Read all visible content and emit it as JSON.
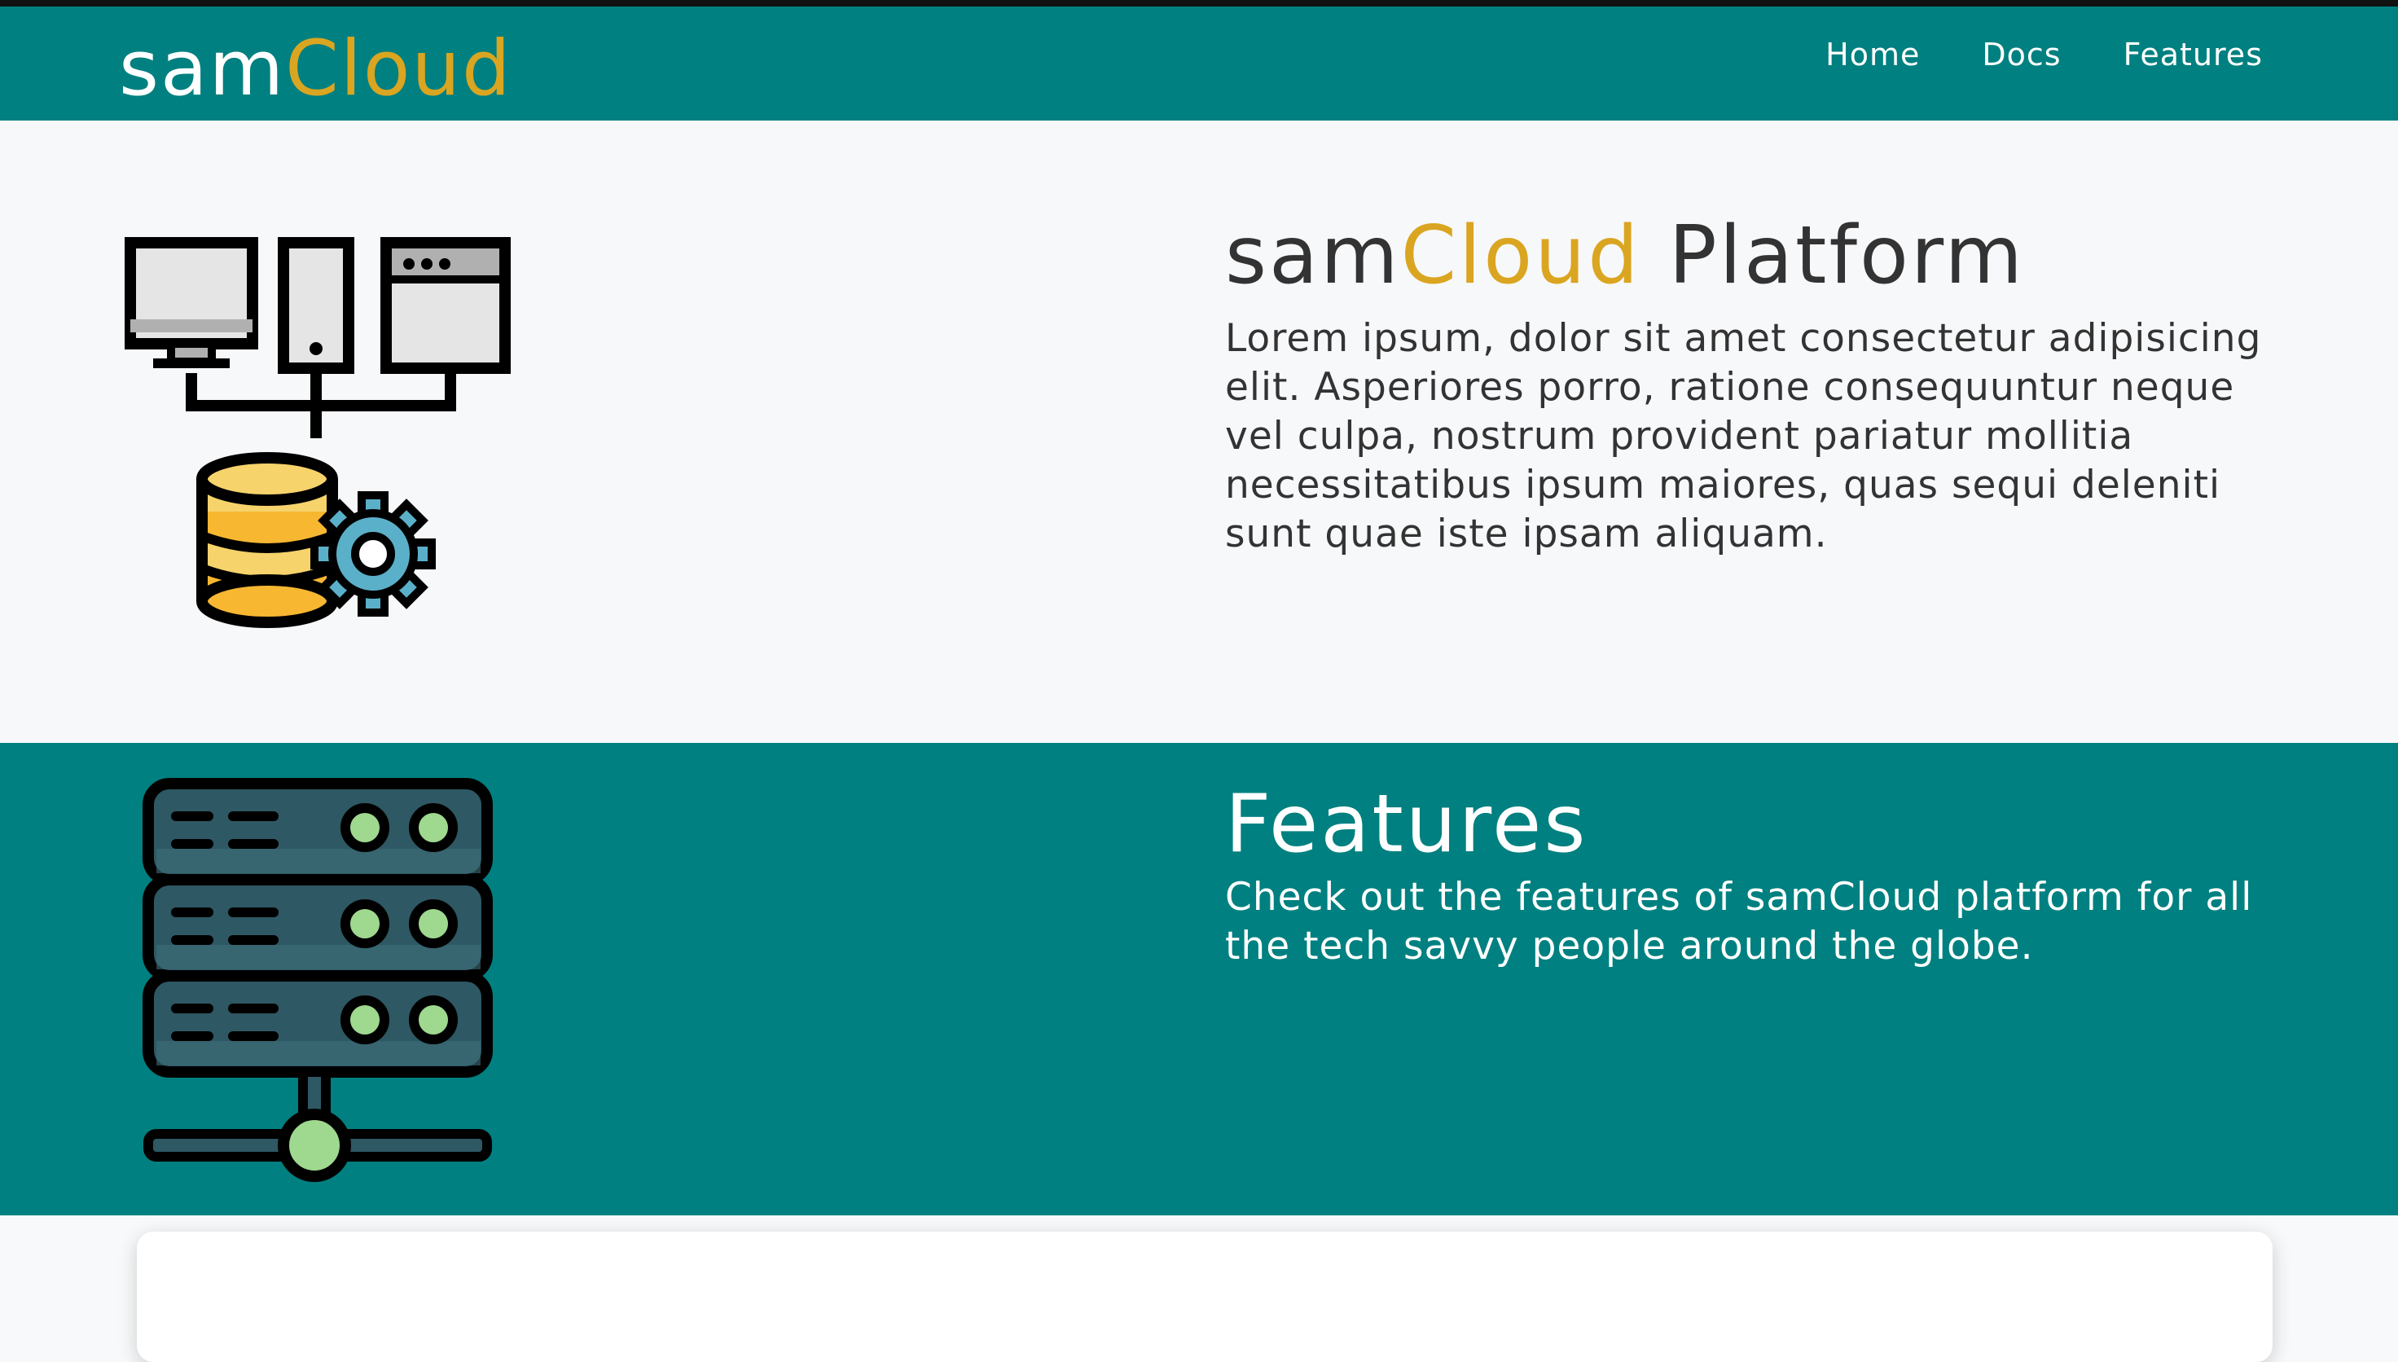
{
  "brand": {
    "part1": "sam",
    "part2": "Cloud"
  },
  "nav": [
    {
      "label": "Home"
    },
    {
      "label": "Docs"
    },
    {
      "label": "Features"
    }
  ],
  "hero": {
    "title_part1": "sam",
    "title_part2": "Cloud",
    "title_part3": " Platform",
    "description": "Lorem ipsum, dolor sit amet consectetur adipisicing elit. Asperiores porro, ratione consequuntur neque vel culpa, nostrum provident pariatur mollitia necessitatibus ipsum maiores, quas sequi deleniti sunt quae iste ipsam aliquam."
  },
  "features": {
    "title": "Features",
    "description": "Check out the features of samCloud platform for all the tech savvy people around the globe."
  },
  "icons": {
    "hero": "devices-database-gear-icon",
    "features": "server-rack-icon"
  },
  "colors": {
    "primary": "#008080",
    "accent": "#daa520",
    "hero_bg": "#f7f8fa",
    "text_dark": "#333333",
    "white": "#ffffff"
  }
}
